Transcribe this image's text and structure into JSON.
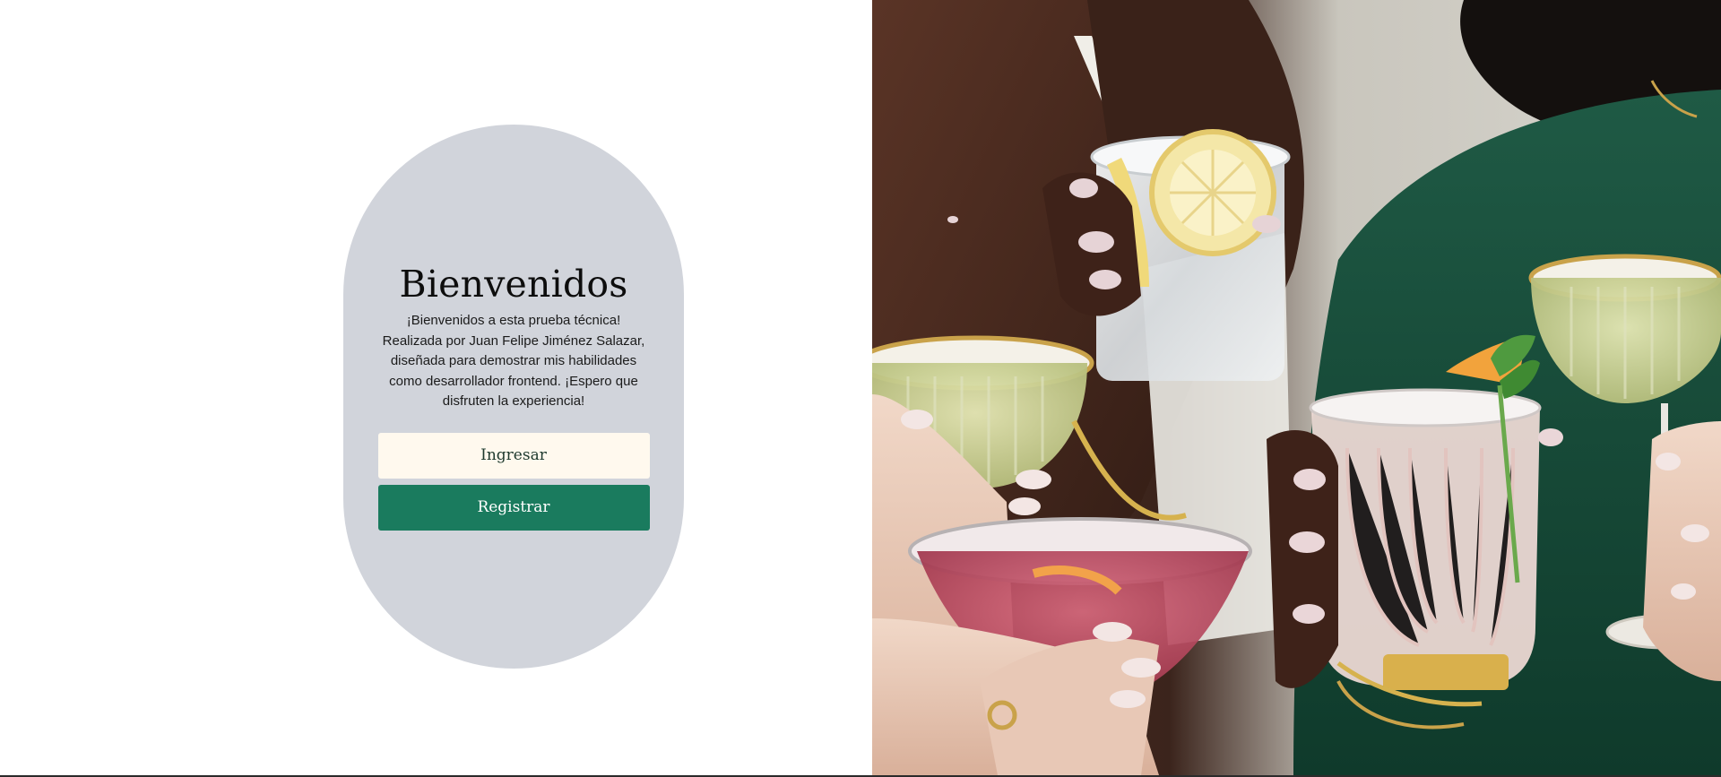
{
  "welcome": {
    "title": "Bienvenidos",
    "description": "¡Bienvenidos a esta prueba técnica! Realizada por Juan Felipe Jiménez Salazar, diseñada para demostrar mis habilidades como desarrollador frontend. ¡Espero que disfruten la experiencia!",
    "login_label": "Ingresar",
    "register_label": "Registrar"
  },
  "hero_image": {
    "icon": "cocktails-photo"
  },
  "colors": {
    "card_background": "#d1d4db",
    "login_button": "#fff9ee",
    "register_button": "#1a7b5e",
    "page_background": "#ffffff"
  }
}
